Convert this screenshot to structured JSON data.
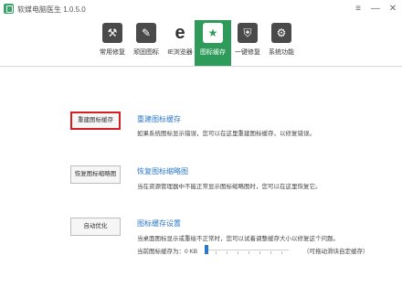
{
  "app": {
    "title": "软媒电脑医生 1.0.5.0"
  },
  "window_controls": {
    "menu": "≡",
    "minimize": "—",
    "close": "✕"
  },
  "toolbar": {
    "tools": [
      {
        "label": "常用修复",
        "icon": "repair-icon",
        "glyph": "⚒"
      },
      {
        "label": "顽固图标",
        "icon": "stubborn-icon-icon",
        "glyph": "✎"
      },
      {
        "label": "IE浏览器",
        "icon": "ie-browser-icon",
        "glyph": "e"
      },
      {
        "label": "图标缓存",
        "icon": "icon-cache-icon",
        "glyph": "★"
      },
      {
        "label": "一键修复",
        "icon": "one-click-repair-icon",
        "glyph": "⛨"
      },
      {
        "label": "系统功能",
        "icon": "system-function-icon",
        "glyph": "⚙"
      }
    ],
    "active_index": 3
  },
  "sections": [
    {
      "button": "重建图标缓存",
      "title": "重建图标缓存",
      "desc": "如果系统图标显示错误，您可以在这里重建图标缓存，以修复错误。"
    },
    {
      "button": "恢复图标缩略图",
      "title": "恢复图标缩略图",
      "desc": "当在资源管理器中不能正常显示图标缩略图时，您可以在这里恢复它。"
    },
    {
      "button": "自动优化",
      "title": "图标缓存设置",
      "desc": "当桌面图标显示或重绘不正常时，您可以试着调整缓存大小以修复这个问题。"
    }
  ],
  "cache_setting": {
    "size_label": "当前图标缓存为：0 KB",
    "slider_value_fraction": 0,
    "hint": "（可拖动滑块自定缓存）"
  },
  "colors": {
    "accent_green": "#2f9b5a",
    "link_blue": "#2a78c8",
    "highlight_red": "#d62020"
  }
}
